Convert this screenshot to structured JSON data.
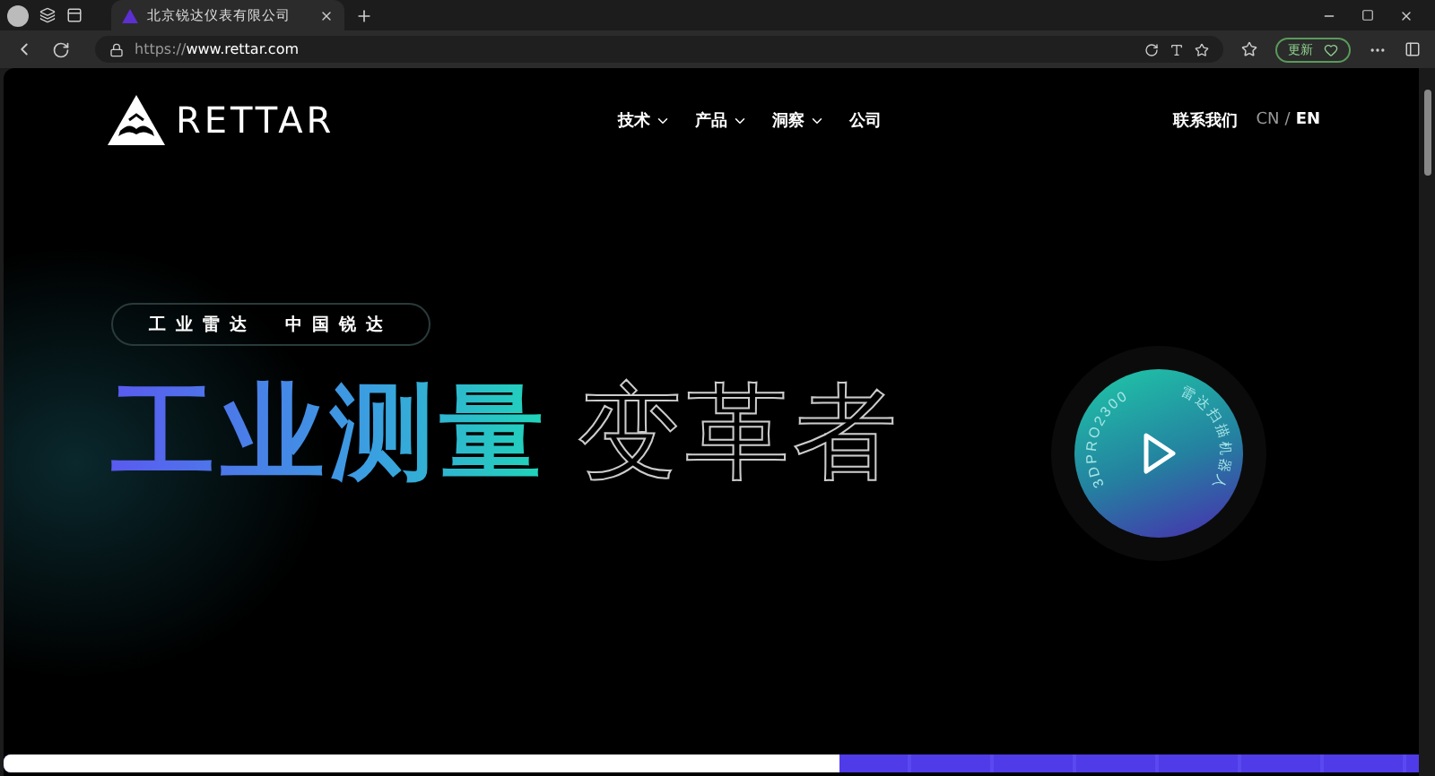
{
  "browser": {
    "tab": {
      "title": "北京锐达仪表有限公司"
    },
    "address": {
      "scheme": "https://",
      "host": "www.rettar.com"
    },
    "update_button": "更新"
  },
  "nav": {
    "logo": "RETTAR",
    "items": [
      {
        "label": "技术",
        "dropdown": true
      },
      {
        "label": "产品",
        "dropdown": true
      },
      {
        "label": "洞察",
        "dropdown": true
      },
      {
        "label": "公司",
        "dropdown": false
      }
    ],
    "contact": "联系我们",
    "language_separator": "/",
    "languages": [
      {
        "label": "CN",
        "selected": false
      },
      {
        "label": "EN",
        "selected": true
      }
    ]
  },
  "hero": {
    "tagline": [
      "工业雷达",
      "中国锐达"
    ],
    "headline_gradient": "工业测量",
    "headline_outline": "变革者",
    "video": {
      "ring_model": "3DPRO2300",
      "ring_name": "雷达扫描机器人"
    }
  },
  "progress": {
    "level": 0.59
  }
}
